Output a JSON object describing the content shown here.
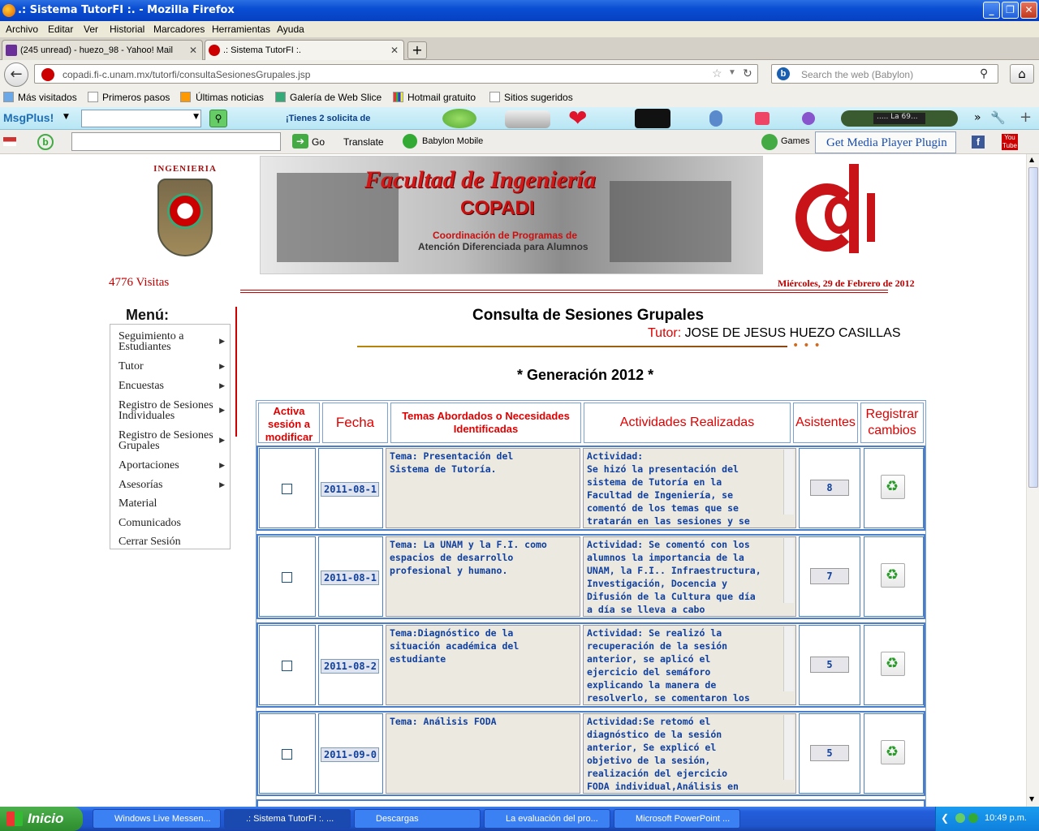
{
  "window": {
    "title": ".: Sistema TutorFI :. - Mozilla Firefox"
  },
  "menubar": [
    "Archivo",
    "Editar",
    "Ver",
    "Historial",
    "Marcadores",
    "Herramientas",
    "Ayuda"
  ],
  "tabs": [
    {
      "label": "(245 unread) - huezo_98 - Yahoo! Mail"
    },
    {
      "label": ".: Sistema TutorFI :."
    }
  ],
  "nav": {
    "url": "copadi.fi-c.unam.mx/tutorfi/consultaSesionesGrupales.jsp",
    "search_placeholder": "Search the web (Babylon)"
  },
  "bookmarks": [
    "Más visitados",
    "Primeros pasos",
    "Últimas noticias",
    "Galería de Web Slice",
    "Hotmail gratuito",
    "Sitios sugeridos"
  ],
  "msgplus": {
    "brand": "MsgPlus!",
    "notice": "¡Tienes 2 solicita de",
    "radio": "..... La 69..."
  },
  "babylon": {
    "go": "Go",
    "translate": "Translate",
    "mobile": "Babylon Mobile",
    "games": "Games",
    "plugin": "Get Media Player Plugin"
  },
  "header": {
    "shield_text": "INGENIERIA",
    "banner_title": "Facultad de Ingeniería",
    "banner_sub": "COPADI",
    "banner_line1": "Coordinación de Programas de",
    "banner_line2": "Atención Diferenciada para Alumnos",
    "visits": "4776 Visitas",
    "date": "Miércoles, 29 de Febrero de 2012"
  },
  "sidemenu": {
    "title": "Menú:",
    "items": [
      {
        "label": "Seguimiento a Estudiantes",
        "arrow": true
      },
      {
        "label": "Tutor",
        "arrow": true
      },
      {
        "label": "Encuestas",
        "arrow": true
      },
      {
        "label": "Registro de Sesiones Individuales",
        "arrow": true
      },
      {
        "label": "Registro de Sesiones Grupales",
        "arrow": true
      },
      {
        "label": "Aportaciones",
        "arrow": true
      },
      {
        "label": "Asesorías",
        "arrow": true
      },
      {
        "label": "Material",
        "arrow": false
      },
      {
        "label": "Comunicados",
        "arrow": false
      },
      {
        "label": "Cerrar Sesión",
        "arrow": false
      }
    ]
  },
  "main": {
    "title": "Consulta de Sesiones Grupales",
    "tutor_label": "Tutor:",
    "tutor_name": "JOSE DE JESUS HUEZO CASILLAS",
    "generation": "* Generación 2012 *"
  },
  "table": {
    "headers": [
      "Activa sesión a modificar",
      "Fecha",
      "Temas Abordados o Necesidades Identificadas",
      "Actividades Realizadas",
      "Asistentes",
      "Registrar cambios"
    ],
    "rows": [
      {
        "date": "2011-08-1:",
        "tema": "Tema: Presentación del\nSistema de Tutoría.",
        "actividad": "Actividad:\nSe hizó la presentación del\nsistema de Tutoría en la\nFacultad de Ingeniería, se\ncomentó de los temas que se\ntratarán en las sesiones y se",
        "asistentes": "8"
      },
      {
        "date": "2011-08-1!",
        "tema": "Tema: La UNAM y la F.I. como\nespacios de desarrollo\nprofesional y humano.",
        "actividad": "Actividad: Se comentó con los\nalumnos la importancia de la\nUNAM, la F.I.. Infraestructura,\nInvestigación, Docencia y\nDifusión de la Cultura que día\na día se lleva a cabo",
        "asistentes": "7"
      },
      {
        "date": "2011-08-2!",
        "tema": "Tema:Diagnóstico de la\nsituación académica del\nestudiante",
        "actividad": "Actividad: Se realizó la\nrecuperación de la sesión\nanterior, se aplicó el\nejercicio del semáforo\nexplicando la manera de\nresolverlo, se comentaron los",
        "asistentes": "5"
      },
      {
        "date": "2011-09-0:",
        "tema": "Tema: Análisis FODA",
        "actividad": "Actividad:Se retomó el\ndiagnóstico de la sesión\nanterior, Se explicó el\nobjetivo de la sesión,\nrealización del ejercicio\nFODA individual,Análisis en",
        "asistentes": "5"
      }
    ]
  },
  "taskbar": {
    "start": "Inicio",
    "items": [
      "Windows Live Messen...",
      ".: Sistema TutorFI :. ...",
      "Descargas",
      "La evaluación del pro...",
      "Microsoft PowerPoint ..."
    ],
    "clock": "10:49 p.m."
  }
}
